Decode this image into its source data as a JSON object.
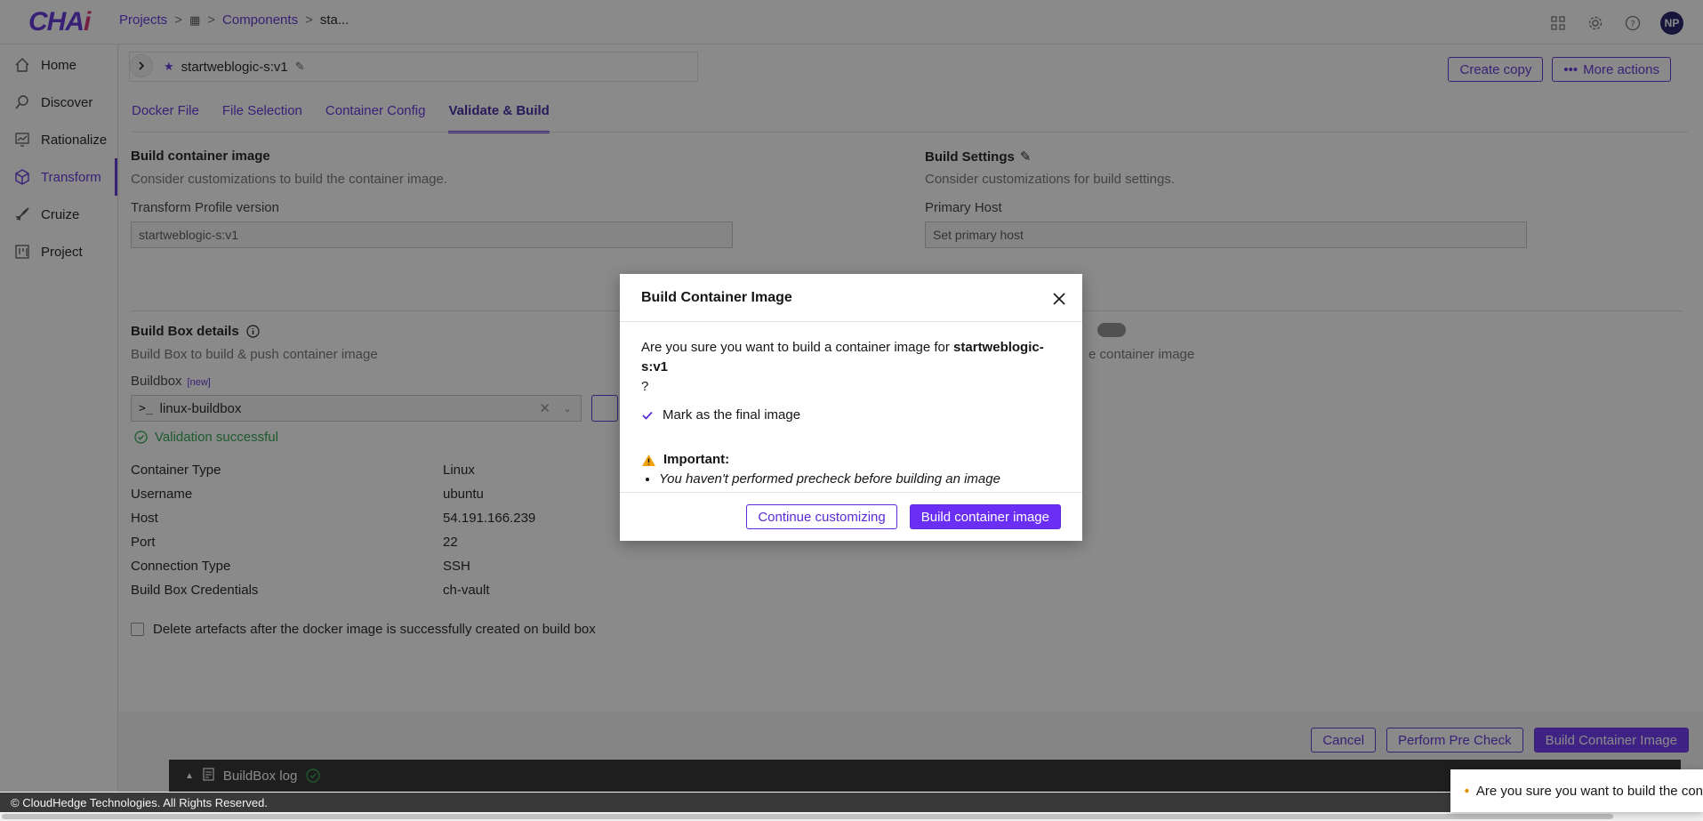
{
  "app": {
    "logo_main": "CHA",
    "logo_accent": "i",
    "avatar_initials": "NP"
  },
  "breadcrumb": {
    "projects": "Projects",
    "components": "Components",
    "current": "sta..."
  },
  "sidebar": {
    "items": [
      {
        "label": "Home",
        "icon": "home-icon"
      },
      {
        "label": "Discover",
        "icon": "search-icon"
      },
      {
        "label": "Rationalize",
        "icon": "chart-icon"
      },
      {
        "label": "Transform",
        "icon": "cube-icon",
        "active": true
      },
      {
        "label": "Cruize",
        "icon": "rocket-icon"
      },
      {
        "label": "Project",
        "icon": "board-icon"
      }
    ]
  },
  "header": {
    "component_name": "startweblogic-s:v1",
    "create_copy": "Create copy",
    "more_actions": "More actions"
  },
  "tabs": [
    "Docker File",
    "File Selection",
    "Container Config",
    "Validate & Build"
  ],
  "build": {
    "title": "Build container image",
    "subtitle": "Consider customizations to build the container image.",
    "profile_label": "Transform Profile version",
    "profile_value": "startweblogic-s:v1"
  },
  "settings": {
    "title": "Build Settings",
    "subtitle": "Consider customizations for build settings.",
    "host_label": "Primary Host",
    "host_placeholder": "Set primary host",
    "partial_text": "e container image"
  },
  "buildbox": {
    "title": "Build Box details",
    "subtitle": "Build Box to build & push container image",
    "label": "Buildbox",
    "new_tag": "[new]",
    "selected": "linux-buildbox",
    "validation": "Validation successful",
    "details": [
      {
        "k": "Container Type",
        "v": "Linux"
      },
      {
        "k": "Username",
        "v": "ubuntu"
      },
      {
        "k": "Host",
        "v": "54.191.166.239"
      },
      {
        "k": "Port",
        "v": "22"
      },
      {
        "k": "Connection Type",
        "v": "SSH"
      },
      {
        "k": "Build Box Credentials",
        "v": "ch-vault"
      }
    ],
    "delete_artefacts": "Delete artefacts after the docker image is successfully created on build box"
  },
  "actions": {
    "cancel": "Cancel",
    "precheck": "Perform Pre Check",
    "build": "Build Container Image"
  },
  "log": {
    "label": "BuildBox log"
  },
  "footer": {
    "copyright": "© CloudHedge Technologies. All Rights Reserved."
  },
  "modal": {
    "title": "Build Container Image",
    "question": "Are you sure you want to build a container image for",
    "component": "startweblogic-s:v1",
    "question_end": "?",
    "final_label": "Mark as the final image",
    "important": "Important:",
    "warning": "You haven't performed precheck before building an image",
    "continue": "Continue customizing",
    "build": "Build container image"
  },
  "toast": {
    "text": "Are you sure you want to build the con"
  },
  "colors": {
    "accent": "#5a2bd8",
    "primary_btn": "#6b2ef5",
    "success": "#24a148",
    "warning": "#f1a20b"
  }
}
